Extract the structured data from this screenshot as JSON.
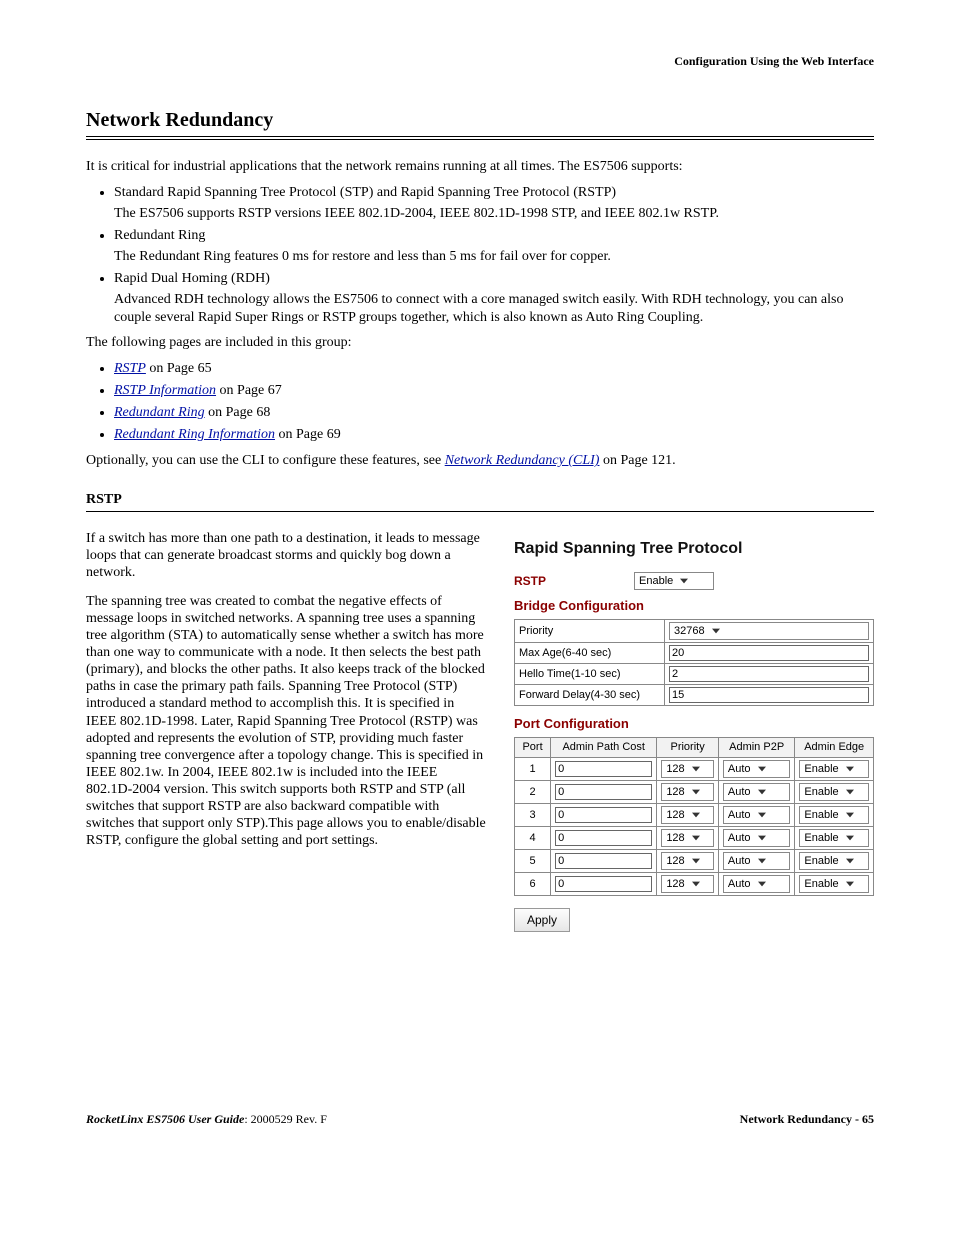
{
  "header": {
    "running": "Configuration Using the Web Interface"
  },
  "title": "Network Redundancy",
  "intro": {
    "lead": "It is critical for industrial applications that the network remains running at all times. The ES7506 supports:",
    "bullets": [
      {
        "head": "Standard Rapid Spanning Tree Protocol (STP) and Rapid Spanning Tree Protocol (RSTP)",
        "body": "The ES7506 supports RSTP versions IEEE 802.1D-2004, IEEE 802.1D-1998 STP, and IEEE 802.1w RSTP."
      },
      {
        "head": "Redundant Ring",
        "body": "The Redundant Ring features 0 ms for restore and less than 5 ms for fail over for copper."
      },
      {
        "head": "Rapid Dual Homing (RDH)",
        "body": "Advanced RDH technology allows the ES7506 to connect with a core managed switch easily. With RDH technology, you can also couple several Rapid Super Rings or RSTP groups together, which is also known as Auto Ring Coupling."
      }
    ],
    "p2": "The following pages are included in this group:",
    "links": [
      {
        "label": "RSTP",
        "suffix": " on Page 65"
      },
      {
        "label": "RSTP Information",
        "suffix": " on Page 67"
      },
      {
        "label": "Redundant Ring",
        "suffix": " on Page 68"
      },
      {
        "label": "Redundant Ring Information",
        "suffix": " on Page 69"
      }
    ],
    "p3_pre": "Optionally, you can use the CLI to configure these features, see ",
    "p3_link": "Network Redundancy (CLI)",
    "p3_post": " on Page 121."
  },
  "rstp": {
    "heading": "RSTP",
    "p1": "If a switch has more than one path to a destination, it leads to message loops that can generate broadcast storms and quickly bog down a network.",
    "p2": "The spanning tree was created to combat the negative effects of message loops in switched networks. A spanning tree uses a spanning tree algorithm (STA) to automatically sense whether a switch has more than one way to communicate with a node. It then selects the best path (primary), and blocks the other paths. It also keeps track of the blocked paths in case the primary path fails. Spanning Tree Protocol (STP) introduced a standard method to accomplish this. It is specified in IEEE 802.1D-1998. Later, Rapid Spanning Tree Protocol (RSTP) was adopted and represents the evolution of STP, providing much faster spanning tree convergence after a topology change. This is specified in IEEE 802.1w. In 2004, IEEE 802.1w is included into the IEEE 802.1D-2004 version. This switch supports both RSTP and STP (all switches that support RSTP are also backward compatible with switches that support only STP).This page allows you to enable/disable RSTP, configure the global setting and port settings."
  },
  "panel": {
    "title": "Rapid Spanning Tree Protocol",
    "mode_label": "RSTP",
    "mode_value": "Enable",
    "bridge_heading": "Bridge Configuration",
    "bridge_rows": [
      {
        "label": "Priority",
        "value": "32768",
        "type": "select"
      },
      {
        "label": "Max Age(6-40 sec)",
        "value": "20",
        "type": "input"
      },
      {
        "label": "Hello Time(1-10 sec)",
        "value": "2",
        "type": "input"
      },
      {
        "label": "Forward Delay(4-30 sec)",
        "value": "15",
        "type": "input"
      }
    ],
    "port_heading": "Port Configuration",
    "port_headers": [
      "Port",
      "Admin Path Cost",
      "Priority",
      "Admin P2P",
      "Admin Edge"
    ],
    "port_rows": [
      {
        "port": "1",
        "cost": "0",
        "priority": "128",
        "p2p": "Auto",
        "edge": "Enable"
      },
      {
        "port": "2",
        "cost": "0",
        "priority": "128",
        "p2p": "Auto",
        "edge": "Enable"
      },
      {
        "port": "3",
        "cost": "0",
        "priority": "128",
        "p2p": "Auto",
        "edge": "Enable"
      },
      {
        "port": "4",
        "cost": "0",
        "priority": "128",
        "p2p": "Auto",
        "edge": "Enable"
      },
      {
        "port": "5",
        "cost": "0",
        "priority": "128",
        "p2p": "Auto",
        "edge": "Enable"
      },
      {
        "port": "6",
        "cost": "0",
        "priority": "128",
        "p2p": "Auto",
        "edge": "Enable"
      }
    ],
    "apply": "Apply"
  },
  "footer": {
    "product": "RocketLinx ES7506  User Guide",
    "rev": ": 2000529 Rev. F",
    "pageref": "Network Redundancy - 65"
  }
}
